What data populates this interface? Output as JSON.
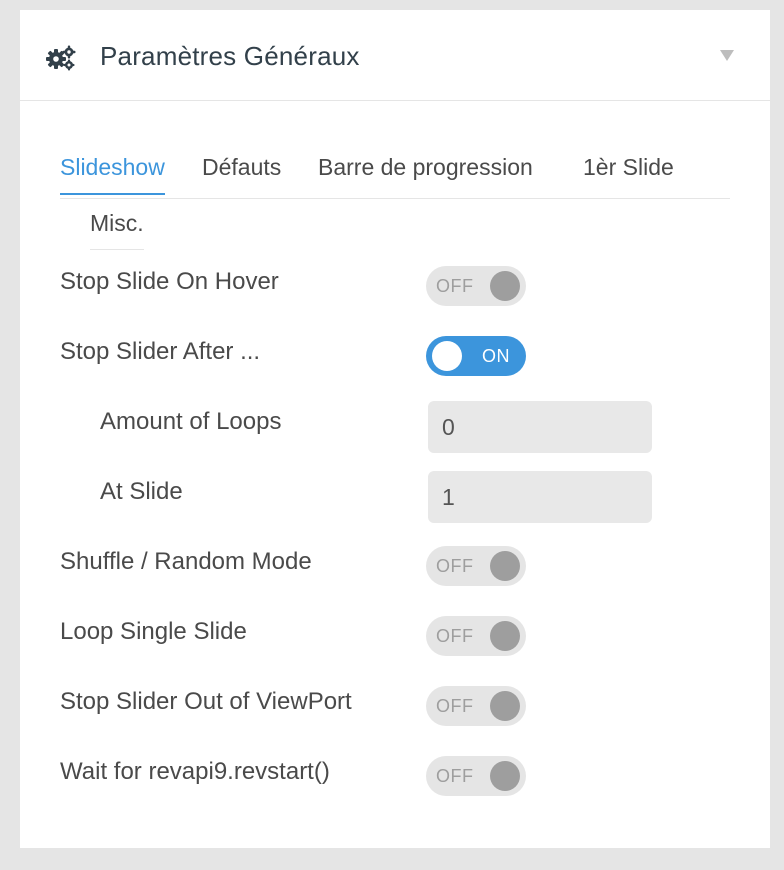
{
  "panel": {
    "title": "Paramètres Généraux",
    "icon": "gears-icon",
    "collapse_icon": "triangle-down-icon"
  },
  "tabs": [
    "Slideshow",
    "Défauts",
    "Barre de progression",
    "1èr Slide",
    "Misc."
  ],
  "active_tab": "Slideshow",
  "settings": {
    "stop_on_hover": {
      "label": "Stop Slide On Hover",
      "state": "OFF"
    },
    "stop_after": {
      "label": "Stop Slider After ...",
      "state": "ON"
    },
    "amount_of_loops": {
      "label": "Amount of Loops",
      "value": "0"
    },
    "at_slide": {
      "label": "At Slide",
      "value": "1"
    },
    "shuffle": {
      "label": "Shuffle / Random Mode",
      "state": "OFF"
    },
    "loop_single": {
      "label": "Loop Single Slide",
      "state": "OFF"
    },
    "out_of_viewport": {
      "label": "Stop Slider Out of ViewPort",
      "state": "OFF"
    },
    "wait_revstart": {
      "label": "Wait for revapi9.revstart()",
      "state": "OFF"
    }
  },
  "colors": {
    "accent": "#3c95dc",
    "toggle_off_bg": "#e5e5e5",
    "knob_off": "#9e9e9e",
    "title": "#32404a"
  }
}
